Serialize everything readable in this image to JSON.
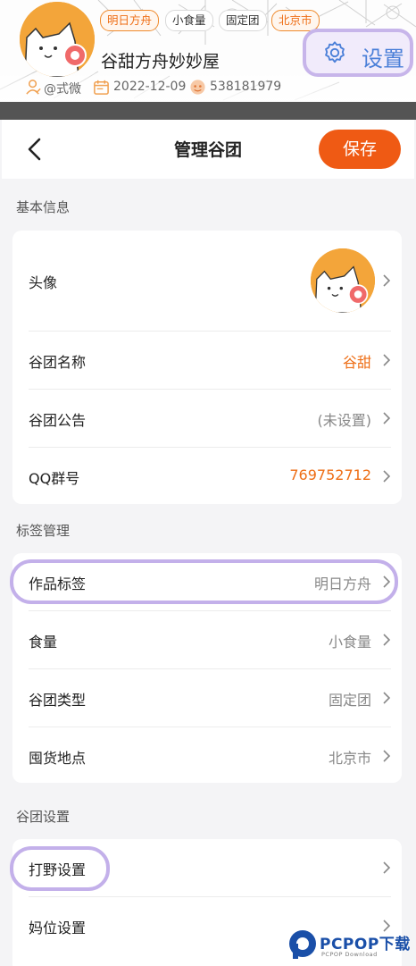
{
  "banner": {
    "tags": [
      "明日方舟",
      "小食量",
      "固定团",
      "北京市"
    ],
    "group_name": "谷甜方舟妙妙屋",
    "owner": "@式微",
    "date": "2022-12-09",
    "id_number": "538181979",
    "settings_label": "设置"
  },
  "navbar": {
    "title": "管理谷团",
    "save_label": "保存"
  },
  "sections": {
    "basic": {
      "title": "基本信息",
      "avatar_label": "头像",
      "name_label": "谷团名称",
      "name_value": "谷甜",
      "notice_label": "谷团公告",
      "notice_value": "(未设置)",
      "qq_label": "QQ群号",
      "qq_value": "769752712"
    },
    "tags": {
      "title": "标签管理",
      "work_label": "作品标签",
      "work_value": "明日方舟",
      "food_label": "食量",
      "food_value": "小食量",
      "type_label": "谷团类型",
      "type_value": "固定团",
      "location_label": "囤货地点",
      "location_value": "北京市"
    },
    "group_settings": {
      "title": "谷团设置",
      "wild_label": "打野设置",
      "mom_label": "妈位设置"
    }
  },
  "watermark": {
    "brand": "PCPOP下载",
    "sub": "PCPOP Download"
  },
  "colors": {
    "accent_orange": "#ef5a14",
    "value_orange": "#ee6e16",
    "highlight_purple": "#c3b0ea",
    "settings_blue": "#4a7fd8"
  }
}
